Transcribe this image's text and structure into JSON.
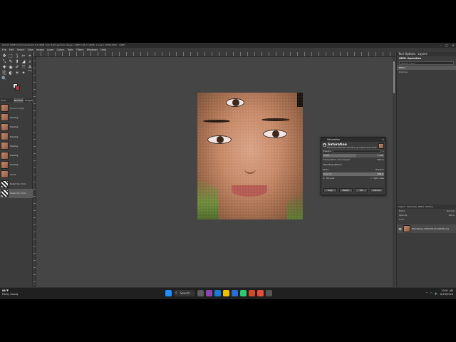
{
  "window": {
    "title": "[Gimpi GIMP Girl] (imported)-19.0 (RGB color 8-bit gamma integer, GIMP built-in sRGB, 1 layer) 2784x3450 – GIMP"
  },
  "menu": [
    "File",
    "Edit",
    "Select",
    "View",
    "Image",
    "Layer",
    "Colors",
    "Tools",
    "Filters",
    "Windows",
    "Help"
  ],
  "toolbox": {
    "tools": [
      "✥",
      "⬚",
      "⟆",
      "✂",
      "⌖",
      "⤡",
      "✎",
      "⬆",
      "◢",
      "⌕",
      "✚",
      "◉",
      "✐",
      "⤧",
      "A",
      "⎘",
      "◐",
      "☀",
      "✦",
      "⌒",
      "🔍"
    ]
  },
  "history": {
    "tabs": [
      "Undo History",
      "Brushes",
      "Images"
    ],
    "items": [
      {
        "label": "[Base Image]",
        "kind": "image"
      },
      {
        "label": "Healing",
        "kind": "image"
      },
      {
        "label": "Healing",
        "kind": "image"
      },
      {
        "label": "Healing",
        "kind": "image"
      },
      {
        "label": "Healing",
        "kind": "image"
      },
      {
        "label": "Healing",
        "kind": "image"
      },
      {
        "label": "Healing",
        "kind": "image"
      },
      {
        "label": "Clone",
        "kind": "image"
      },
      {
        "label": "Select by Color",
        "kind": "selection"
      },
      {
        "label": "Select by Color",
        "kind": "selection"
      }
    ]
  },
  "status": {
    "unit": "px",
    "zoom": "33.3 %",
    "info": "Saturation (566.5 kB) Modifying (17 kB)"
  },
  "gegl": {
    "tabs": [
      "Tool Options",
      "Layers"
    ],
    "title": "GEGL Operation",
    "search_placeholder": "Search a tool",
    "rows": [
      "Filters",
      "Colors ▸"
    ]
  },
  "layers": {
    "tabs": [
      "Layers",
      "Channels",
      "Paths",
      "History"
    ],
    "mode_label": "Mode",
    "mode_value": "Normal",
    "opacity_label": "Opacity",
    "opacity_value": "100.0",
    "lock_label": "Lock:",
    "layer_name": "Expressive-2049-06-12-94429.png"
  },
  "dialog": {
    "title": "Saturation",
    "heading": "Saturation",
    "subtitle": "Expressive-2049-06-12-94429.png-3 ([Expressive-2049-06-12-94429] (imported))",
    "presets_label": "Presets:",
    "scale_label": "Scale",
    "scale_value": "1.415",
    "colorspace_label": "Interpolation Color Space",
    "colorspace_value": "Native",
    "blending_label": "Blending Options",
    "mode_label": "Mode",
    "mode_value": "Replace",
    "opacity_label": "Opacity",
    "opacity_value": "100.0",
    "preview_label": "Preview",
    "split_label": "Split view",
    "buttons": [
      "Help",
      "Reset",
      "OK",
      "Cancel"
    ]
  },
  "taskbar": {
    "temp": "84°F",
    "weather": "Partly cloudy",
    "search": "Search",
    "time": "10:01 AM",
    "date": "6/29/2024",
    "apps": [
      "#1e90ff",
      "#2a6fd6",
      "#f0c000",
      "#1a7bd4",
      "#d34a2b",
      "#8e44ad",
      "#2ecc71",
      "#5b5b5b",
      "#e74c3c",
      "#c0392b",
      "#555555"
    ]
  }
}
